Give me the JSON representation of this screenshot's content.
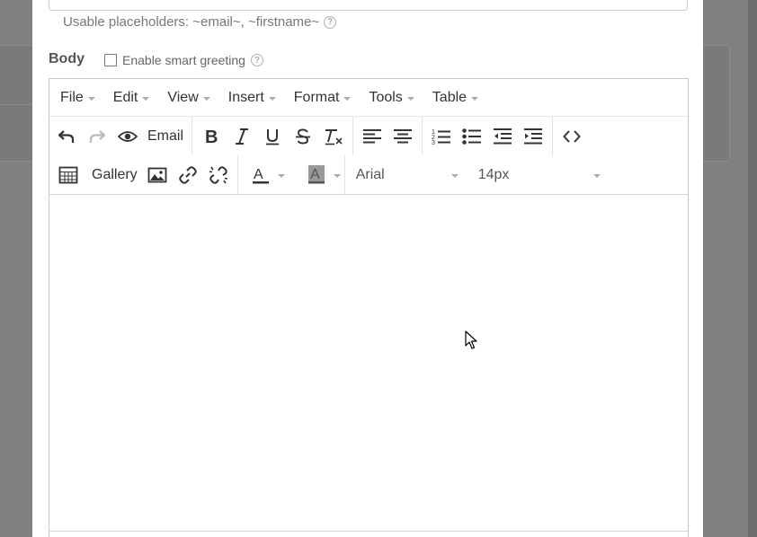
{
  "hint": {
    "text": "Usable placeholders: ~email~, ~firstname~"
  },
  "body_section": {
    "label": "Body",
    "smart_greeting_label": "Enable smart greeting",
    "smart_greeting_checked": false
  },
  "menubar": [
    {
      "label": "File"
    },
    {
      "label": "Edit"
    },
    {
      "label": "View"
    },
    {
      "label": "Insert"
    },
    {
      "label": "Format"
    },
    {
      "label": "Tools"
    },
    {
      "label": "Table"
    }
  ],
  "toolbar": {
    "email_label": "Email",
    "gallery_label": "Gallery",
    "font_family": "Arial",
    "font_size": "14px"
  },
  "icons": [
    "undo-icon",
    "redo-icon",
    "preview-icon",
    "bold-icon",
    "italic-icon",
    "underline-icon",
    "strikethrough-icon",
    "clear-format-icon",
    "align-left-icon",
    "align-center-icon",
    "numbered-list-icon",
    "bullet-list-icon",
    "outdent-icon",
    "indent-icon",
    "source-code-icon",
    "table-icon",
    "image-icon",
    "link-icon",
    "unlink-icon",
    "text-color-icon",
    "background-color-icon"
  ],
  "colors": {
    "text_color": "#333333",
    "highlight_color": "#999999"
  }
}
